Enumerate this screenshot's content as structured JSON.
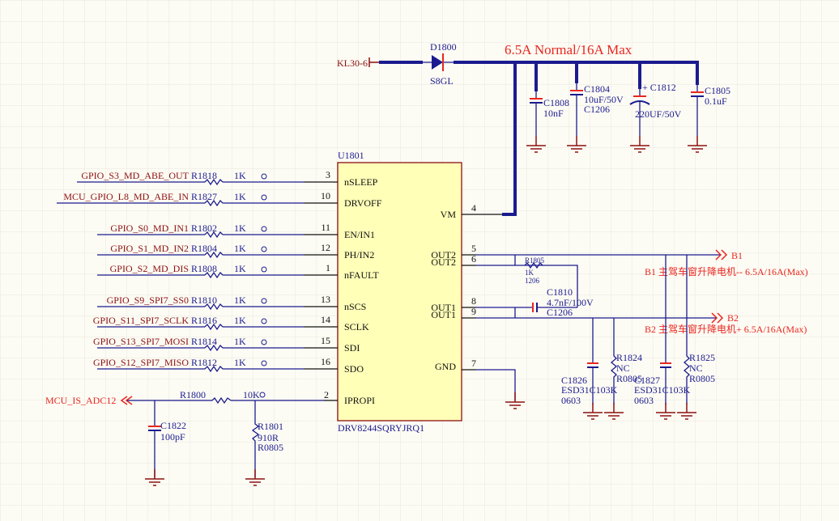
{
  "colors": {
    "wire": "#1b1b8f",
    "net_label": "#e8261f",
    "port": "#8b1010",
    "ic_fill": "#ffffb8"
  },
  "power": {
    "input": "KL30-6",
    "diode_ref": "D1800",
    "diode_value": "S8GL",
    "current_note": "6.5A Normal/16A Max"
  },
  "caps_top": [
    {
      "ref": "C1808",
      "value": "10nF",
      "pkg": ""
    },
    {
      "ref": "C1804",
      "value": "10uF/50V",
      "pkg": "C1206"
    },
    {
      "ref": "+ C1812",
      "value": "220UF/50V",
      "pkg": ""
    },
    {
      "ref": "C1805",
      "value": "0.1uF",
      "pkg": ""
    }
  ],
  "ic": {
    "ref": "U1801",
    "part": "DRV8244SQRYJRQ1",
    "right_pins": [
      {
        "num": "4",
        "name": "VM"
      },
      {
        "num": "5",
        "name": "OUT2"
      },
      {
        "num": "6",
        "name": "OUT2"
      },
      {
        "num": "8",
        "name": "OUT1"
      },
      {
        "num": "9",
        "name": "OUT1"
      },
      {
        "num": "7",
        "name": "GND"
      }
    ]
  },
  "left_rows": [
    {
      "net": "GPIO_S3_MD_ABE_OUT",
      "ref": "R1818",
      "value": "1K",
      "pin": "3",
      "name": "nSLEEP"
    },
    {
      "net": "MCU_GPIO_L8_MD_ABE_IN",
      "ref": "R1827",
      "value": "1K",
      "pin": "10",
      "name": "DRVOFF"
    },
    {
      "net": "GPIO_S0_MD_IN1",
      "ref": "R1802",
      "value": "1K",
      "pin": "11",
      "name": "EN/IN1"
    },
    {
      "net": "GPIO_S1_MD_IN2",
      "ref": "R1804",
      "value": "1K",
      "pin": "12",
      "name": "PH/IN2"
    },
    {
      "net": "GPIO_S2_MD_DIS",
      "ref": "R1808",
      "value": "1K",
      "pin": "1",
      "name": "nFAULT"
    },
    {
      "net": "GPIO_S9_SPI7_SS0",
      "ref": "R1810",
      "value": "1K",
      "pin": "13",
      "name": "nSCS"
    },
    {
      "net": "GPIO_S11_SPI7_SCLK",
      "ref": "R1816",
      "value": "1K",
      "pin": "14",
      "name": "SCLK"
    },
    {
      "net": "GPIO_S13_SPI7_MOSI",
      "ref": "R1814",
      "value": "1K",
      "pin": "15",
      "name": "SDI"
    },
    {
      "net": "GPIO_S12_SPI7_MISO",
      "ref": "R1812",
      "value": "1K",
      "pin": "16",
      "name": "SDO"
    }
  ],
  "ipropi": {
    "net": "MCU_IS_ADC12",
    "res_ref": "R1800",
    "res_value": "10K",
    "pin": "2",
    "name": "IPROPI",
    "cap_ref": "C1822",
    "cap_value": "100pF",
    "r2_ref": "R1801",
    "r2_value": "910R",
    "r2_pkg": "R0805"
  },
  "outputs": {
    "r1805": {
      "ref": "R1805",
      "value": "1K",
      "pkg": "1206"
    },
    "c1810": {
      "ref": "C1810",
      "value": "4.7nF/100V",
      "pkg": "C1206"
    },
    "b1": {
      "port": "B1",
      "desc": "B1 主驾车窗升降电机-- 6.5A/16A(Max)"
    },
    "b2": {
      "port": "B2",
      "desc": "B2 主驾车窗升降电机+ 6.5A/16A(Max)"
    },
    "c1826": {
      "ref": "C1826",
      "value": "ESD31C103K",
      "pkg": "0603"
    },
    "r1824": {
      "ref": "R1824",
      "value": "NC",
      "pkg": "R0805"
    },
    "c1827": {
      "ref": "C1827",
      "value": "ESD31C103K",
      "pkg": "0603"
    },
    "r1825": {
      "ref": "R1825",
      "value": "NC",
      "pkg": "R0805"
    }
  }
}
